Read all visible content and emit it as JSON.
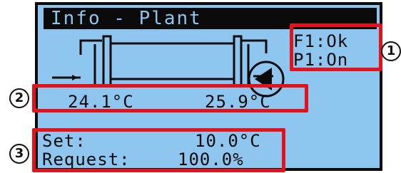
{
  "screen": {
    "title": "Info - Plant",
    "status": {
      "f1": "F1:Ok",
      "p1": "P1:On"
    },
    "temperatures": {
      "inlet": "24.1°C",
      "outlet": "25.9°C"
    },
    "set_label": "Set:",
    "set_value": "10.0°C",
    "request_label": "Request:",
    "request_value": "100.0%"
  },
  "callouts": {
    "one": "1",
    "two": "2",
    "three": "3"
  },
  "colors": {
    "lcd_background": "#8ec6f0",
    "lcd_foreground": "#0b0b0b",
    "highlight": "#e3131b"
  },
  "icons": {
    "heat_exchanger": "heat-exchanger-icon",
    "pump": "pump-icon"
  }
}
